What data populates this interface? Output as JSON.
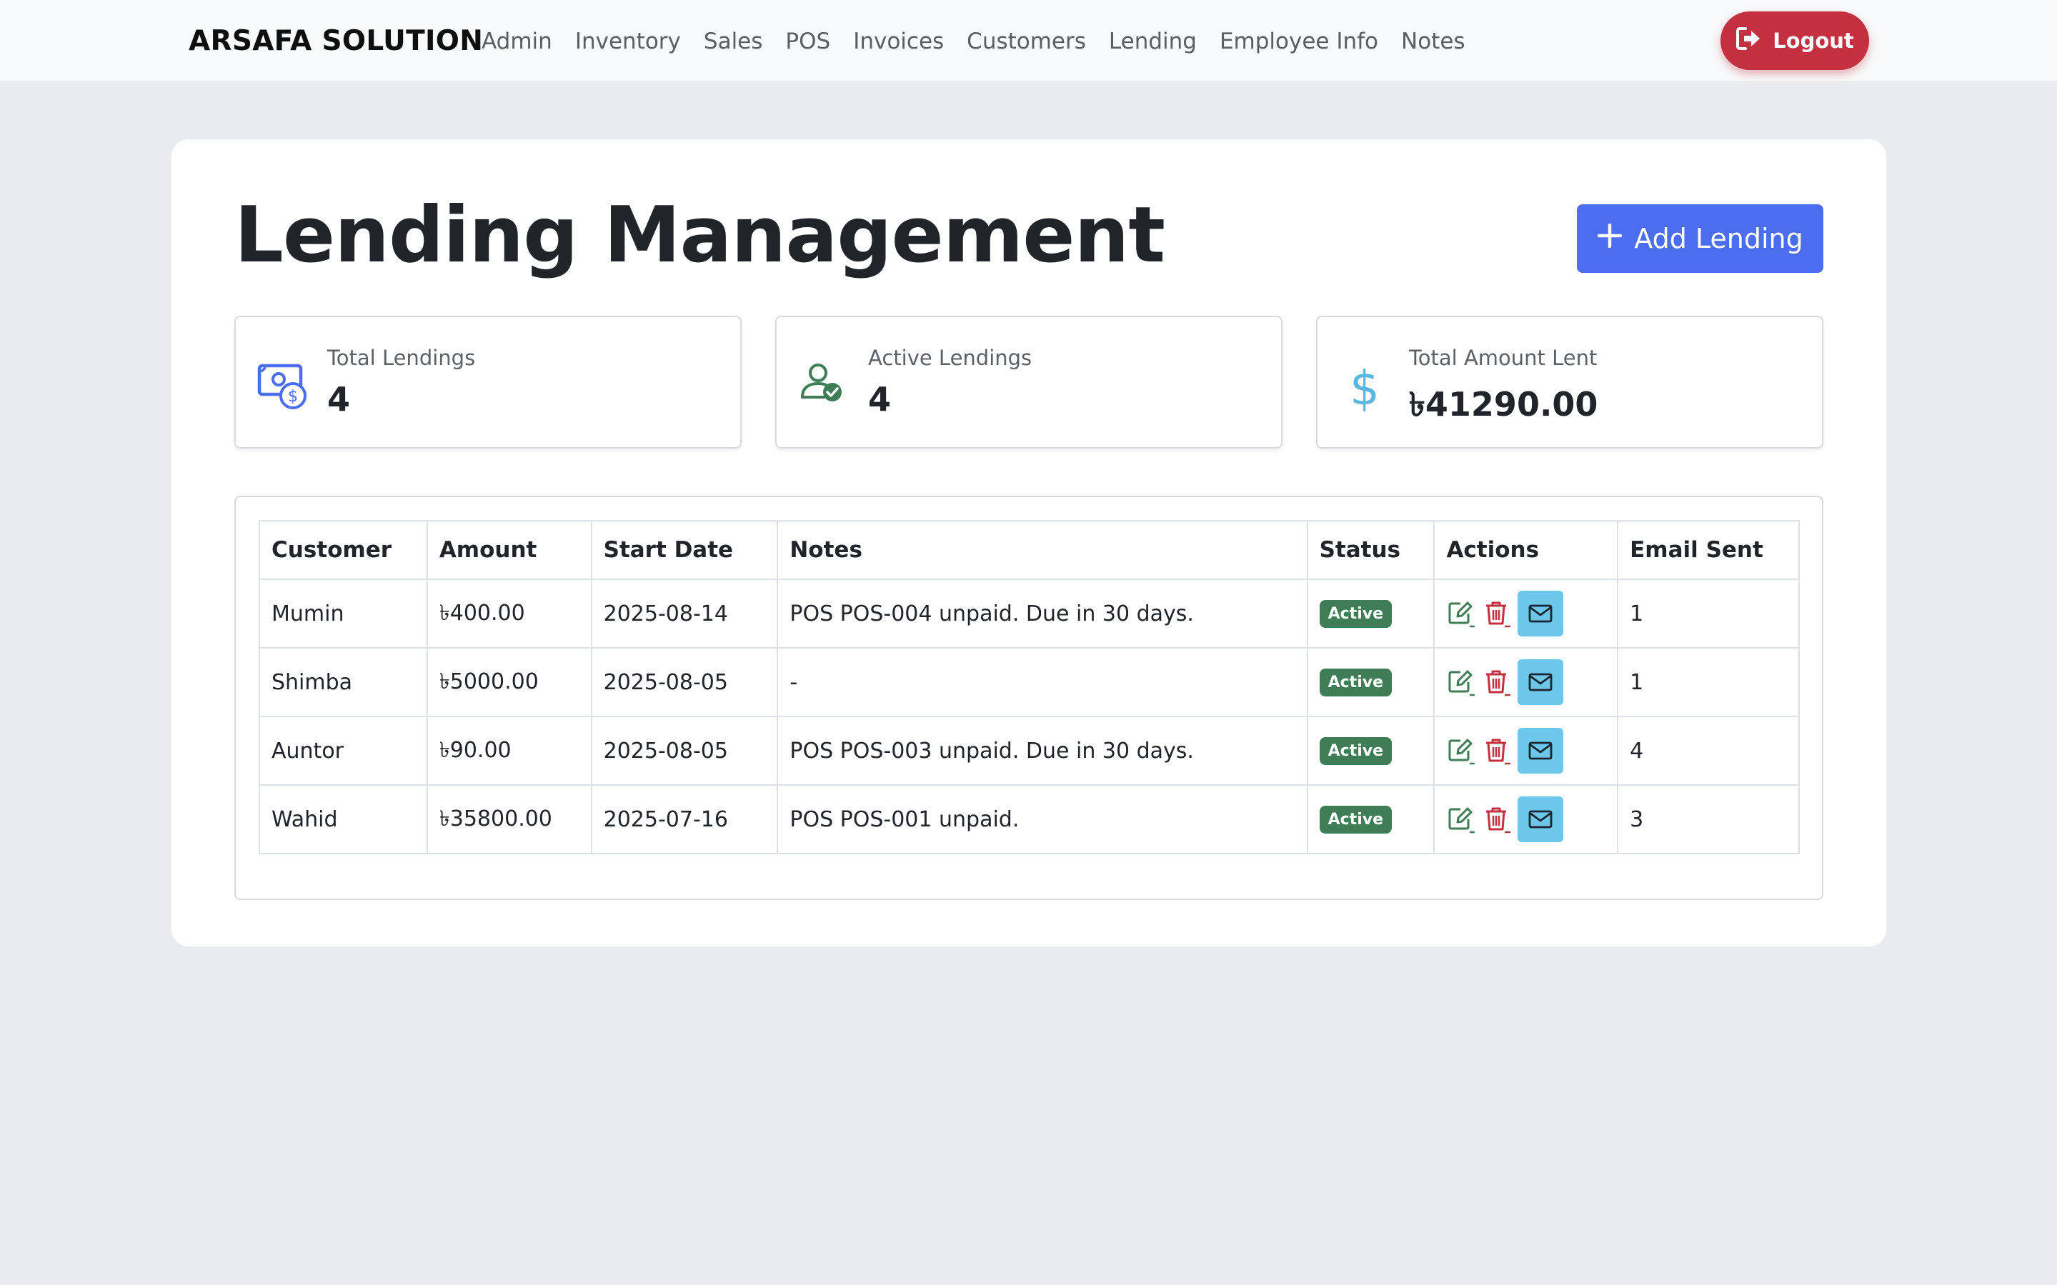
{
  "navbar": {
    "brand": "ARSAFA SOLUTION",
    "links": [
      "Admin",
      "Inventory",
      "Sales",
      "POS",
      "Invoices",
      "Customers",
      "Lending",
      "Employee Info",
      "Notes"
    ],
    "logout_label": "Logout"
  },
  "page": {
    "title": "Lending Management",
    "add_button_label": "Add Lending"
  },
  "stats": [
    {
      "label": "Total Lendings",
      "value": "4",
      "icon": "money-bill-dollar-icon",
      "color": "#4b6df0"
    },
    {
      "label": "Active Lendings",
      "value": "4",
      "icon": "user-check-icon",
      "color": "#3f7d56"
    },
    {
      "label": "Total Amount Lent",
      "value": "৳41290.00",
      "icon": "dollar-icon",
      "color": "#5bb6e0"
    }
  ],
  "table": {
    "headers": [
      "Customer",
      "Amount",
      "Start Date",
      "Notes",
      "Status",
      "Actions",
      "Email Sent"
    ],
    "rows": [
      {
        "customer": "Mumin",
        "amount": "৳400.00",
        "start_date": "2025-08-14",
        "notes": "POS POS-004 unpaid. Due in 30 days.",
        "status": "Active",
        "email_sent": "1"
      },
      {
        "customer": "Shimba",
        "amount": "৳5000.00",
        "start_date": "2025-08-05",
        "notes": "-",
        "status": "Active",
        "email_sent": "1"
      },
      {
        "customer": "Auntor",
        "amount": "৳90.00",
        "start_date": "2025-08-05",
        "notes": "POS POS-003 unpaid. Due in 30 days.",
        "status": "Active",
        "email_sent": "4"
      },
      {
        "customer": "Wahid",
        "amount": "৳35800.00",
        "start_date": "2025-07-16",
        "notes": "POS POS-001 unpaid.",
        "status": "Active",
        "email_sent": "3"
      }
    ]
  },
  "colors": {
    "primary": "#4b6df0",
    "danger": "#c3303f",
    "success": "#3f7d56",
    "info": "#6cc7ea"
  }
}
